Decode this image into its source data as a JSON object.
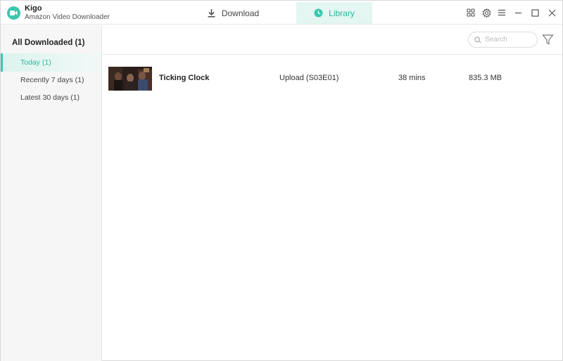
{
  "app": {
    "name": "Kigo",
    "subtitle": "Amazon Video Downloader",
    "logo_icon": "camera-icon",
    "accent_color": "#3cc7ad"
  },
  "tabs": [
    {
      "label": "Download",
      "icon": "download-icon",
      "active": false
    },
    {
      "label": "Library",
      "icon": "clock-icon",
      "active": true
    }
  ],
  "window_controls": [
    "apps-grid-icon",
    "gear-icon",
    "menu-icon",
    "minimize-icon",
    "maximize-icon",
    "close-icon"
  ],
  "sidebar": {
    "heading": "All Downloaded (1)",
    "items": [
      {
        "label": "Today (1)",
        "active": true
      },
      {
        "label": "Recently 7 days (1)",
        "active": false
      },
      {
        "label": "Latest 30 days (1)",
        "active": false
      }
    ]
  },
  "toolbar": {
    "search_placeholder": "Search",
    "filter_icon": "filter-icon"
  },
  "library": {
    "rows": [
      {
        "title": "Ticking Clock",
        "episode": "Upload (S03E01)",
        "duration": "38 mins",
        "size": "835.3 MB"
      }
    ]
  }
}
